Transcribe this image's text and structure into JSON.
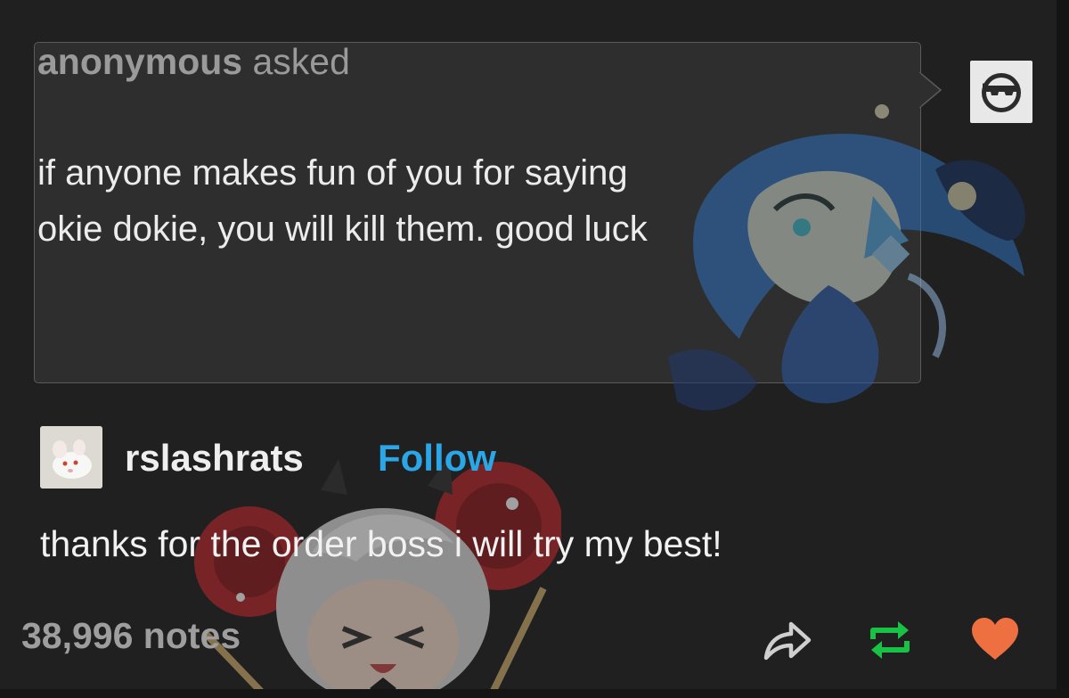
{
  "ask": {
    "asker": "anonymous",
    "asked_word": "asked",
    "question_line1": "if anyone makes fun of you for saying",
    "question_line2": "okie dokie, you will kill them. good luck"
  },
  "asker_avatar_icon": "sunglasses-face-icon",
  "reply": {
    "username": "rslashrats",
    "follow_label": "Follow",
    "text": "thanks for the order boss i will try my best!"
  },
  "footer": {
    "notes": "38,996 notes",
    "share_icon": "share-arrow-icon",
    "reblog_icon": "reblog-icon",
    "like_icon": "heart-icon"
  },
  "colors": {
    "background": "#202020",
    "ask_box": "#2e2e2e",
    "follow": "#2ba7e8",
    "reblog": "#18c244",
    "like": "#ee6f3f"
  }
}
